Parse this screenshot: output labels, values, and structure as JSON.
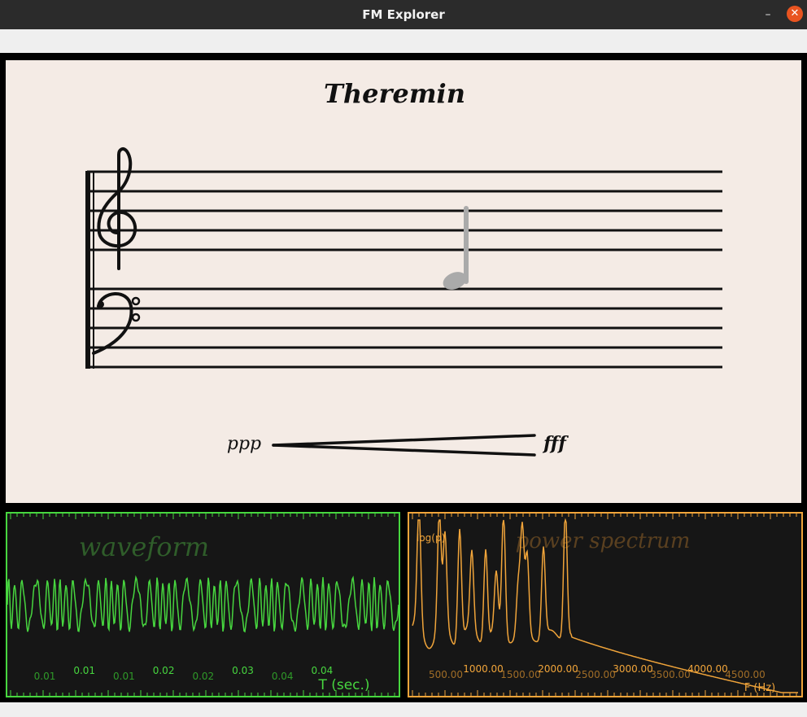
{
  "window": {
    "title": "FM Explorer",
    "minimize_glyph": "–",
    "close_glyph": "✕"
  },
  "score": {
    "title": "Theremin",
    "dynamics": {
      "start": "ppp",
      "end": "fff"
    },
    "note": {
      "type": "quarter",
      "color": "#aaaaaa"
    },
    "colors": {
      "paper": "#f4ebe5",
      "ink": "#111111"
    }
  },
  "waveform": {
    "title": "waveform",
    "color": "#47d63f",
    "x_ticks": [
      "0.01",
      "0.01",
      "0.01",
      "0.02",
      "0.02",
      "0.03",
      "0.04",
      "0.04"
    ],
    "x_label": "T (sec.)"
  },
  "spectrum": {
    "title": "power spectrum",
    "color": "#f0a43a",
    "y_label": "log(p)",
    "x_ticks_low": [
      "500.00",
      "1500.00",
      "2500.00",
      "3500.00",
      "4500.00"
    ],
    "x_ticks_high": [
      "1000.00",
      "2000.00",
      "3000.00",
      "4000.00"
    ],
    "x_label": "F (Hz)"
  }
}
